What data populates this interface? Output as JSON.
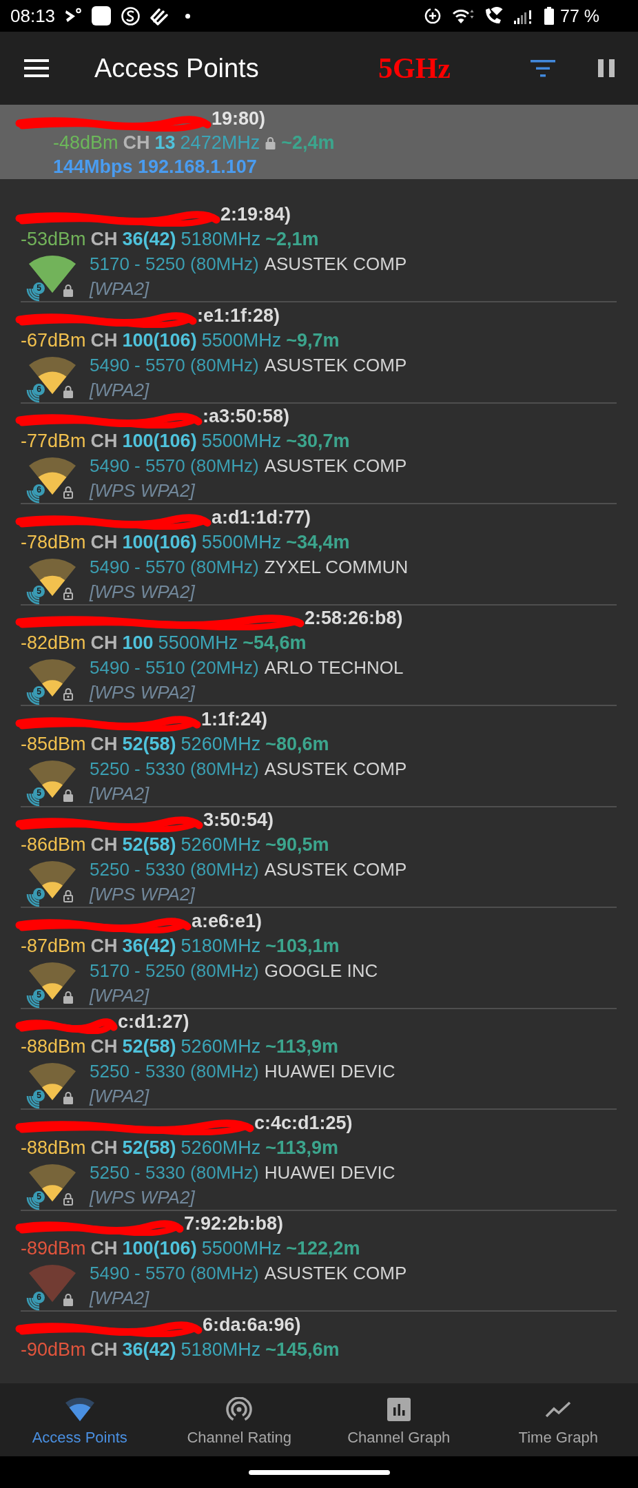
{
  "status_bar": {
    "time": "08:13",
    "battery": "77 %"
  },
  "app_bar": {
    "title": "Access Points",
    "annotation": "5GHz"
  },
  "connected": {
    "title": "19:80)",
    "signal": "-48dBm",
    "color": "#6cb85a",
    "channel_label": "CH",
    "channel": "13",
    "frequency": "2472MHz",
    "distance": "~2,4m",
    "link": "144Mbps 192.168.1.107"
  },
  "access_points": [
    {
      "title": "2:19:84)",
      "signal": "-53dBm",
      "color": "#72b35a",
      "signal_icon": {
        "kind": "full"
      },
      "channel_label": "CH",
      "channel": "36(42)",
      "frequency": "5180MHz",
      "distance": "~2,1m",
      "wifi_standard": "5",
      "lock_outline": false,
      "range": "5170 - 5250 (80MHz)",
      "vendor": "ASUSTEK COMP",
      "security": "[WPA2]"
    },
    {
      "title": ":e1:1f:28)",
      "signal": "-67dBm",
      "color": "#f2c14e",
      "signal_icon": {
        "kind": "high"
      },
      "channel_label": "CH",
      "channel": "100(106)",
      "frequency": "5500MHz",
      "distance": "~9,7m",
      "wifi_standard": "6",
      "lock_outline": false,
      "range": "5490 - 5570 (80MHz)",
      "vendor": "ASUSTEK COMP",
      "security": "[WPA2]"
    },
    {
      "title": ":a3:50:58)",
      "signal": "-77dBm",
      "color": "#f2c14e",
      "signal_icon": {
        "kind": "high"
      },
      "channel_label": "CH",
      "channel": "100(106)",
      "frequency": "5500MHz",
      "distance": "~30,7m",
      "wifi_standard": "6",
      "lock_outline": true,
      "range": "5490 - 5570 (80MHz)",
      "vendor": "ASUSTEK COMP",
      "security": "[WPS WPA2]"
    },
    {
      "title": "a:d1:1d:77)",
      "signal": "-78dBm",
      "color": "#f2c14e",
      "signal_icon": {
        "kind": "medium"
      },
      "channel_label": "CH",
      "channel": "100(106)",
      "frequency": "5500MHz",
      "distance": "~34,4m",
      "wifi_standard": "5",
      "lock_outline": true,
      "range": "5490 - 5570 (80MHz)",
      "vendor": "ZYXEL COMMUN",
      "security": "[WPS WPA2]"
    },
    {
      "title": "2:58:26:b8)",
      "signal": "-82dBm",
      "color": "#f2c14e",
      "signal_icon": {
        "kind": "low"
      },
      "channel_label": "CH",
      "channel": "100",
      "frequency": "5500MHz",
      "distance": "~54,6m",
      "wifi_standard": "5",
      "lock_outline": true,
      "range": "5490 - 5510 (20MHz)",
      "vendor": "ARLO TECHNOL",
      "security": "[WPS WPA2]"
    },
    {
      "title": "1:1f:24)",
      "signal": "-85dBm",
      "color": "#f2c14e",
      "signal_icon": {
        "kind": "low"
      },
      "channel_label": "CH",
      "channel": "52(58)",
      "frequency": "5260MHz",
      "distance": "~80,6m",
      "wifi_standard": "5",
      "lock_outline": false,
      "range": "5250 - 5330 (80MHz)",
      "vendor": "ASUSTEK COMP",
      "security": "[WPA2]"
    },
    {
      "title": "3:50:54)",
      "signal": "-86dBm",
      "color": "#f2c14e",
      "signal_icon": {
        "kind": "low"
      },
      "channel_label": "CH",
      "channel": "52(58)",
      "frequency": "5260MHz",
      "distance": "~90,5m",
      "wifi_standard": "6",
      "lock_outline": true,
      "range": "5250 - 5330 (80MHz)",
      "vendor": "ASUSTEK COMP",
      "security": "[WPS WPA2]"
    },
    {
      "title": "a:e6:e1)",
      "signal": "-87dBm",
      "color": "#f2c14e",
      "signal_icon": {
        "kind": "low"
      },
      "channel_label": "CH",
      "channel": "36(42)",
      "frequency": "5180MHz",
      "distance": "~103,1m",
      "wifi_standard": "5",
      "lock_outline": false,
      "range": "5170 - 5250 (80MHz)",
      "vendor": "GOOGLE INC",
      "security": "[WPA2]"
    },
    {
      "title": "c:d1:27)",
      "signal": "-88dBm",
      "color": "#f2c14e",
      "signal_icon": {
        "kind": "low"
      },
      "channel_label": "CH",
      "channel": "52(58)",
      "frequency": "5260MHz",
      "distance": "~113,9m",
      "wifi_standard": "5",
      "lock_outline": false,
      "range": "5250 - 5330 (80MHz)",
      "vendor": "HUAWEI DEVIC",
      "security": "[WPA2]"
    },
    {
      "title": "c:4c:d1:25)",
      "signal": "-88dBm",
      "color": "#f2c14e",
      "signal_icon": {
        "kind": "low"
      },
      "channel_label": "CH",
      "channel": "52(58)",
      "frequency": "5260MHz",
      "distance": "~113,9m",
      "wifi_standard": "5",
      "lock_outline": true,
      "range": "5250 - 5330 (80MHz)",
      "vendor": "HUAWEI DEVIC",
      "security": "[WPS WPA2]"
    },
    {
      "title": "7:92:2b:b8)",
      "signal": "-89dBm",
      "color": "#e2553d",
      "signal_icon": {
        "kind": "empty"
      },
      "channel_label": "CH",
      "channel": "100(106)",
      "frequency": "5500MHz",
      "distance": "~122,2m",
      "wifi_standard": "6",
      "lock_outline": false,
      "range": "5490 - 5570 (80MHz)",
      "vendor": "ASUSTEK COMP",
      "security": "[WPA2]"
    },
    {
      "title": "6:da:6a:96)",
      "signal": "-90dBm",
      "color": "#e2553d",
      "channel_label": "CH",
      "channel": "36(42)",
      "frequency": "5180MHz",
      "distance": "~145,6m"
    }
  ],
  "bottom_nav": [
    {
      "label": "Access Points",
      "kind": "wifi",
      "selected": true
    },
    {
      "label": "Channel Rating",
      "kind": "radar",
      "selected": false
    },
    {
      "label": "Channel Graph",
      "kind": "barchart",
      "selected": false
    },
    {
      "label": "Time Graph",
      "kind": "trend",
      "selected": false
    }
  ]
}
